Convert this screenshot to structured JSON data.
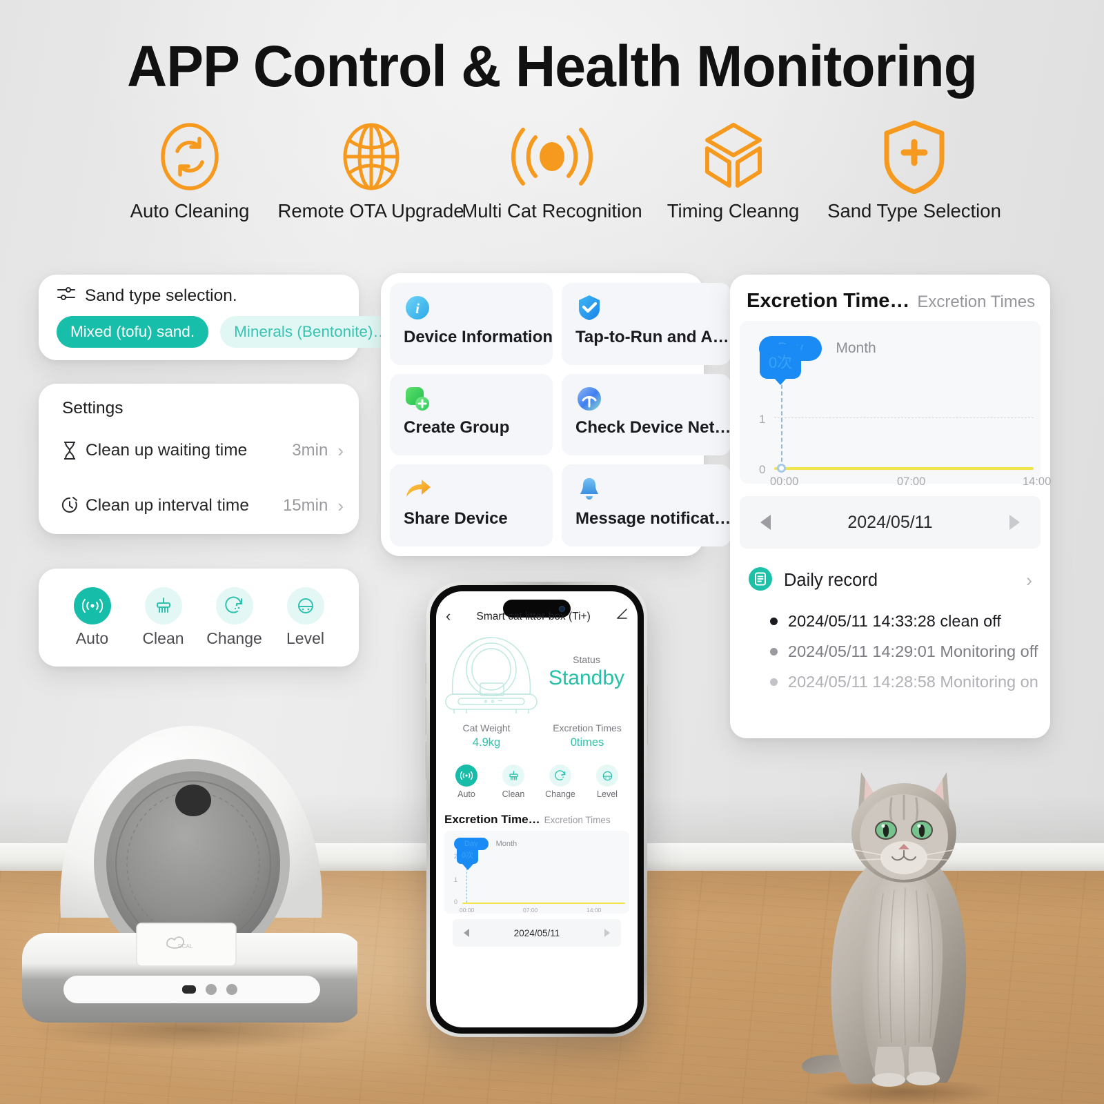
{
  "headline": "APP Control & Health Monitoring",
  "features": [
    {
      "icon": "auto-cleaning-icon",
      "label": "Auto Cleaning"
    },
    {
      "icon": "globe-ota-icon",
      "label": "Remote OTA Upgrade"
    },
    {
      "icon": "multi-cat-sensor-icon",
      "label": "Multi Cat Recognition"
    },
    {
      "icon": "cube-timing-icon",
      "label": "Timing Cleanng"
    },
    {
      "icon": "shield-plus-icon",
      "label": "Sand Type Selection"
    }
  ],
  "colors": {
    "accent_orange": "#F59A1E",
    "accent_teal": "#17BEAA",
    "accent_blue": "#1A8BF5",
    "chart_line_yellow": "#F2E34B",
    "wall": "#E7E7E7",
    "floor": "#CFA26F"
  },
  "sand_card": {
    "icon": "sliders-icon",
    "title": "Sand type selection.",
    "options": [
      {
        "label": "Mixed (tofu) sand.",
        "selected": true
      },
      {
        "label": "Minerals (Bentonite)…",
        "selected": false
      }
    ]
  },
  "settings_card": {
    "title": "Settings",
    "rows": [
      {
        "icon": "hourglass-icon",
        "label": "Clean up waiting time",
        "value": "3min",
        "chevron": "›"
      },
      {
        "icon": "stopwatch-icon",
        "label": "Clean up interval time",
        "value": "15min",
        "chevron": "›"
      }
    ]
  },
  "actions_card": {
    "items": [
      {
        "icon": "wifi-signal-icon",
        "label": "Auto",
        "active": true
      },
      {
        "icon": "brush-icon",
        "label": "Clean",
        "active": false
      },
      {
        "icon": "rotate-sand-icon",
        "label": "Change",
        "active": false
      },
      {
        "icon": "level-icon",
        "label": "Level",
        "active": false
      }
    ]
  },
  "menu_grid": {
    "tiles": [
      {
        "icon": "info-circle-icon",
        "label": "Device Information"
      },
      {
        "icon": "check-badge-icon",
        "label": "Tap-to-Run and A…"
      },
      {
        "icon": "create-group-icon",
        "label": "Create Group"
      },
      {
        "icon": "network-check-icon",
        "label": "Check Device Net…"
      },
      {
        "icon": "share-arrow-icon",
        "label": "Share Device"
      },
      {
        "icon": "bell-icon",
        "label": "Message notificat…"
      }
    ]
  },
  "chart_card": {
    "title": "Excretion Time…",
    "subtitle": "Excretion Times",
    "toggle": {
      "day": "Day",
      "month": "Month",
      "selected": "Day"
    },
    "tooltip": "0次",
    "date": "2024/05/11",
    "nav_prev": "◀",
    "nav_next": "▶",
    "daily_record": {
      "icon": "document-icon",
      "label": "Daily record",
      "chevron": "›",
      "entries": [
        {
          "text": "2024/05/11 14:33:28 clean off",
          "opacity": 1.0
        },
        {
          "text": "2024/05/11 14:29:01 Monitoring off",
          "opacity": 0.62
        },
        {
          "text": "2024/05/11 14:28:58 Monitoring on",
          "opacity": 0.34
        }
      ]
    }
  },
  "chart_data": {
    "type": "line",
    "title": "Excretion Time…",
    "subtitle": "Excretion Times",
    "xlabel": "",
    "ylabel": "Excretion Times",
    "x": [
      "00:00",
      "07:00",
      "14:00"
    ],
    "xtick_labels": [
      "00:00",
      "07:00",
      "14:00"
    ],
    "ytick_labels": [
      "0",
      "1",
      "2"
    ],
    "ylim": [
      0,
      2
    ],
    "grid": true,
    "legend": "none",
    "series": [
      {
        "name": "Excretion Times",
        "color": "#F2E34B",
        "values": [
          0,
          0,
          0
        ]
      }
    ],
    "annotations": [
      {
        "label": "0次",
        "x": "00:00",
        "y": 0,
        "style": "tooltip-blue"
      }
    ]
  },
  "phone": {
    "header": {
      "back_icon": "chevron-left-icon",
      "title": "Smart cat litter box  (Ti+)",
      "edit_icon": "pencil-icon"
    },
    "illustration": "litter-box-line-art",
    "status": {
      "label": "Status",
      "value": "Standby"
    },
    "stats": [
      {
        "key": "Cat Weight",
        "value": "4.9kg"
      },
      {
        "key": "Excretion Times",
        "value": "0times"
      }
    ],
    "actions": [
      {
        "icon": "wifi-signal-icon",
        "label": "Auto",
        "active": true
      },
      {
        "icon": "brush-icon",
        "label": "Clean",
        "active": false
      },
      {
        "icon": "rotate-sand-icon",
        "label": "Change",
        "active": false
      },
      {
        "icon": "level-icon",
        "label": "Level",
        "active": false
      }
    ],
    "chart": {
      "title": "Excretion Time…",
      "subtitle": "Excretion Times",
      "toggle": {
        "day": "Day",
        "month": "Month"
      },
      "tooltip": "0次",
      "xtick_labels": [
        "00:00",
        "07:00",
        "14:00"
      ],
      "ytick_labels": [
        "0",
        "1",
        "2"
      ],
      "date": "2024/05/11"
    }
  },
  "scene": {
    "device_brand_mark": "DCAL",
    "cat": "gray-tabby-cat"
  }
}
